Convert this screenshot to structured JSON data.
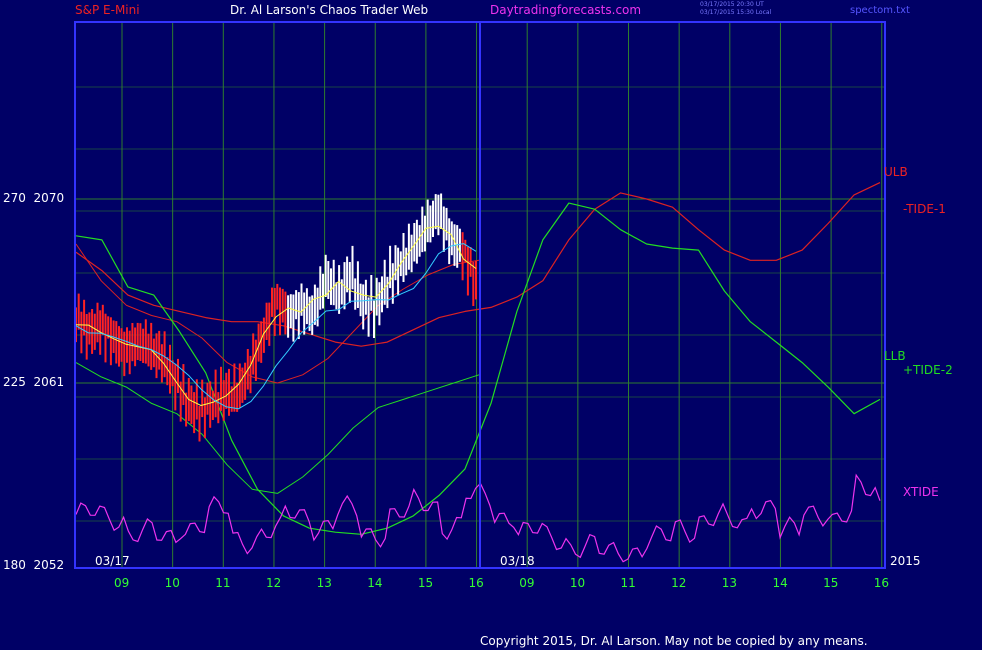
{
  "header": {
    "instrument": "S&P E-Mini",
    "site": "Dr. Al Larson's Chaos Trader Web",
    "url": "Daytradingforecasts.com",
    "timestamp_ut": "03/17/2015 20:30 UT",
    "timestamp_local": "03/17/2015 15:30 Local",
    "file": "spectom.txt"
  },
  "colors": {
    "background": "#000066",
    "frame": "#3333ff",
    "grid": "#2e7d2e",
    "price_up": "#ffffff",
    "price_down": "#ff2222",
    "ulb": "#dd2222",
    "llb": "#22dd22",
    "xtide": "#ee33ee",
    "fast_ma": "#ffff44",
    "slow_ma": "#33ccff"
  },
  "chart_data": {
    "type": "line",
    "title": "S&P E-Mini",
    "y_left_labels": [
      {
        "angle": "270",
        "price": "2070"
      },
      {
        "angle": "225",
        "price": "2061"
      },
      {
        "angle": "180",
        "price": "2052"
      }
    ],
    "ylim": [
      2052,
      2070
    ],
    "x_ticks": [
      "09",
      "10",
      "11",
      "12",
      "13",
      "14",
      "15",
      "16",
      "09",
      "10",
      "11",
      "12",
      "13",
      "14",
      "15",
      "16"
    ],
    "date_labels": [
      "03/17",
      "03/18"
    ],
    "year_label": "2015",
    "series_labels": {
      "ulb": "ULB",
      "tide1": "-TIDE-1",
      "llb": "LLB",
      "tide2": "+TIDE-2",
      "xtide": "XTIDE"
    },
    "series": [
      {
        "name": "ULB",
        "values": [
          2067.4,
          2066.5,
          2065.3,
          2064.8,
          2064.5,
          2064.2,
          2064.0,
          2064.0,
          2063.8,
          2063.4,
          2063.0,
          2062.8,
          2063.0,
          2063.6,
          2064.2,
          2064.5,
          2064.7,
          2065.2,
          2066.0,
          2068.0,
          2069.5,
          2070.3,
          2070.0,
          2069.6,
          2068.5,
          2067.5,
          2067.0,
          2067.0,
          2067.5,
          2068.8,
          2070.2,
          2070.8
        ]
      },
      {
        "name": "LLB",
        "values": [
          2068.2,
          2068.0,
          2065.7,
          2065.3,
          2063.5,
          2061.5,
          2058.2,
          2055.8,
          2054.5,
          2053.9,
          2053.7,
          2053.6,
          2053.9,
          2054.5,
          2055.5,
          2056.8,
          2060.0,
          2064.5,
          2068.0,
          2069.8,
          2069.5,
          2068.5,
          2067.8,
          2067.6,
          2067.5,
          2065.5,
          2064.0,
          2063.0,
          2062.0,
          2060.8,
          2059.5,
          2060.2
        ]
      },
      {
        "name": "XTIDE",
        "values": [
          0.55,
          0.5,
          0.3,
          0.2,
          0.4,
          0.6,
          0.2,
          0.3,
          0.55,
          0.4,
          0.6,
          0.3,
          0.55,
          0.7,
          0.4,
          0.8,
          0.55,
          0.3,
          0.2,
          0.1,
          0.0,
          0.05,
          0.2,
          0.35,
          0.5,
          0.4,
          0.7,
          0.3,
          0.6,
          0.5,
          0.9,
          0.7
        ]
      },
      {
        "name": "price",
        "values": [
          2064.2,
          2063.5,
          2063.8,
          2063.1,
          2062.6,
          2063.0,
          2062.7,
          2062.2,
          2061.0,
          2060.0,
          2059.6,
          2060.1,
          2060.5,
          2060.5,
          2061.8,
          2063.4,
          2065.0,
          2064.3,
          2064.7,
          2064.4,
          2066.2,
          2065.3,
          2066.4,
          2064.8,
          2064.7,
          2066.1,
          2066.8,
          2067.7,
          2068.6,
          2069.4,
          2068.0,
          2067.4,
          2065.8
        ]
      }
    ]
  },
  "copyright": "Copyright 2015, Dr. Al Larson. May not be copied by any means."
}
